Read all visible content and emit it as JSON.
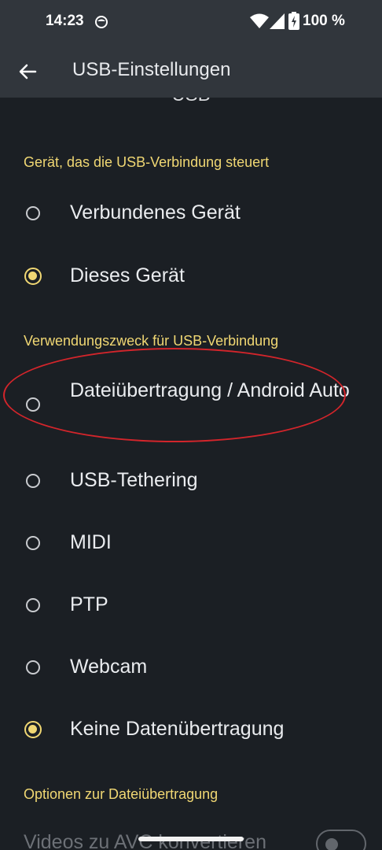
{
  "status_bar": {
    "time": "14:23",
    "battery_percent": "100 %",
    "icons": [
      "app-notification-icon",
      "wifi-icon",
      "cell-signal-icon",
      "battery-charging-icon"
    ]
  },
  "app_bar": {
    "title": "USB-Einstellungen",
    "back_icon": "arrow-back-icon"
  },
  "content": {
    "clipped_heading": "USB",
    "section_control": {
      "title": "Gerät, das die USB-Verbindung steuert",
      "options": [
        {
          "label": "Verbundenes Gerät",
          "selected": false
        },
        {
          "label": "Dieses Gerät",
          "selected": true
        }
      ]
    },
    "section_purpose": {
      "title": "Verwendungszweck für USB-Verbindung",
      "options": [
        {
          "label": "Dateiübertragung / Android Auto",
          "selected": false,
          "highlighted": true
        },
        {
          "label": "USB-Tethering",
          "selected": false
        },
        {
          "label": "MIDI",
          "selected": false
        },
        {
          "label": "PTP",
          "selected": false
        },
        {
          "label": "Webcam",
          "selected": false
        },
        {
          "label": "Keine Datenübertragung",
          "selected": true
        }
      ]
    },
    "section_file_options": {
      "title": "Optionen zur Dateiübertragung",
      "items": [
        {
          "label": "Videos zu AVC konvertieren",
          "enabled": false,
          "toggle_on": false
        }
      ]
    }
  },
  "colors": {
    "background": "#1b1f24",
    "app_bar": "#31363c",
    "accent": "#f0d773",
    "annotation": "#d3252b"
  }
}
